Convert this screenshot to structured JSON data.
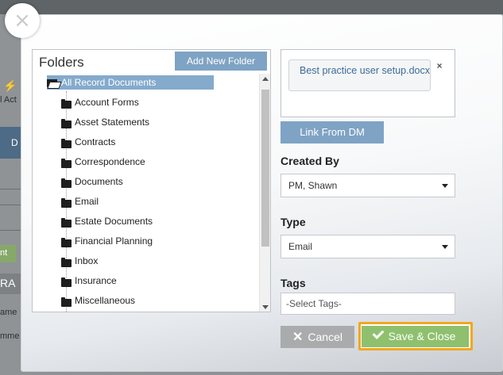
{
  "background": {
    "action_label": "l Act",
    "tab_letter": "D",
    "green_button_label": "nt",
    "tab2_label": "RA",
    "name_label": "ame",
    "comment_label": "mme"
  },
  "dialog": {
    "close_glyph": "×"
  },
  "folders": {
    "title": "Folders",
    "add_button": "Add New Folder",
    "root": "All Record Documents",
    "items": [
      "Account Forms",
      "Asset Statements",
      "Contracts",
      "Correspondence",
      "Documents",
      "Email",
      "Estate Documents",
      "Financial Planning",
      "Inbox",
      "Insurance",
      "Miscellaneous"
    ]
  },
  "attachment": {
    "file_name": "Best practice user setup.docx",
    "remove_glyph": "×"
  },
  "link_button": "Link From DM",
  "created_by": {
    "label": "Created By",
    "value": "PM, Shawn"
  },
  "type": {
    "label": "Type",
    "value": "Email"
  },
  "tags": {
    "label": "Tags",
    "placeholder": "-Select Tags-"
  },
  "buttons": {
    "cancel": "Cancel",
    "save": "Save & Close"
  },
  "colors": {
    "accent_blue": "#7fa3c4",
    "selected_row": "#84aacc",
    "save_green": "#8fc06e",
    "highlight_orange": "#f2a71e",
    "cancel_gray": "#a9abad"
  }
}
